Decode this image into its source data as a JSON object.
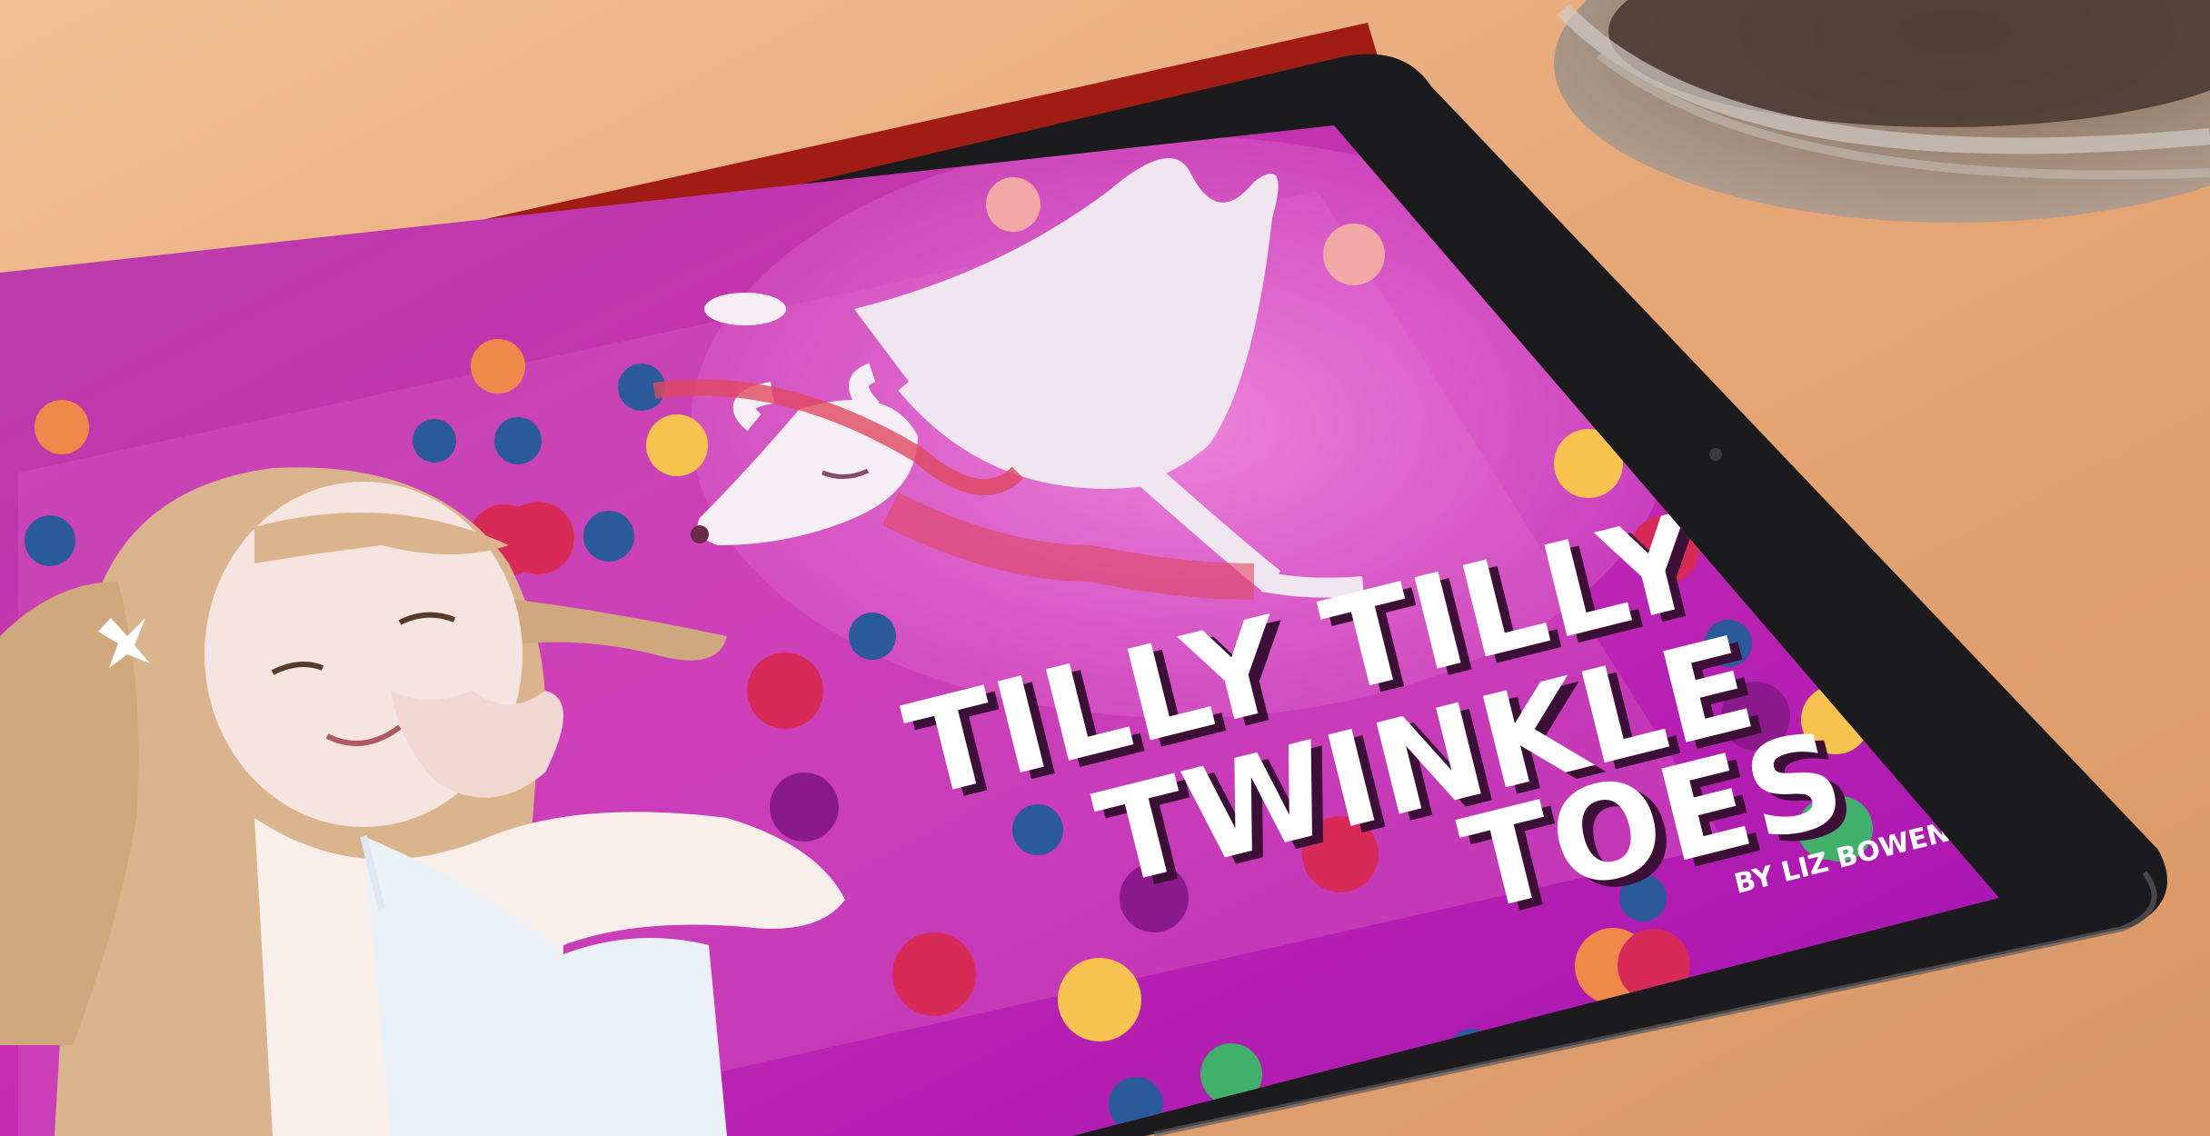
{
  "book_cover": {
    "title_line_1": "TILLY TILLY",
    "title_line_2": "TWINKLE",
    "title_line_3": "TOES",
    "byline": "BY LIZ BOWEN"
  },
  "colors": {
    "table": "#e7a878",
    "tablet_bezel": "#1b1a1c",
    "case_red": "#a01c14",
    "screen_magenta": "#c62cb4",
    "title_white": "#ffffff",
    "title_shadow": "#3c1036"
  },
  "icons": [
    "ipad-tablet",
    "red-smart-cover",
    "silver-bowl",
    "front-camera",
    "girl-illustration",
    "llama-illustration",
    "fruit-dots"
  ]
}
